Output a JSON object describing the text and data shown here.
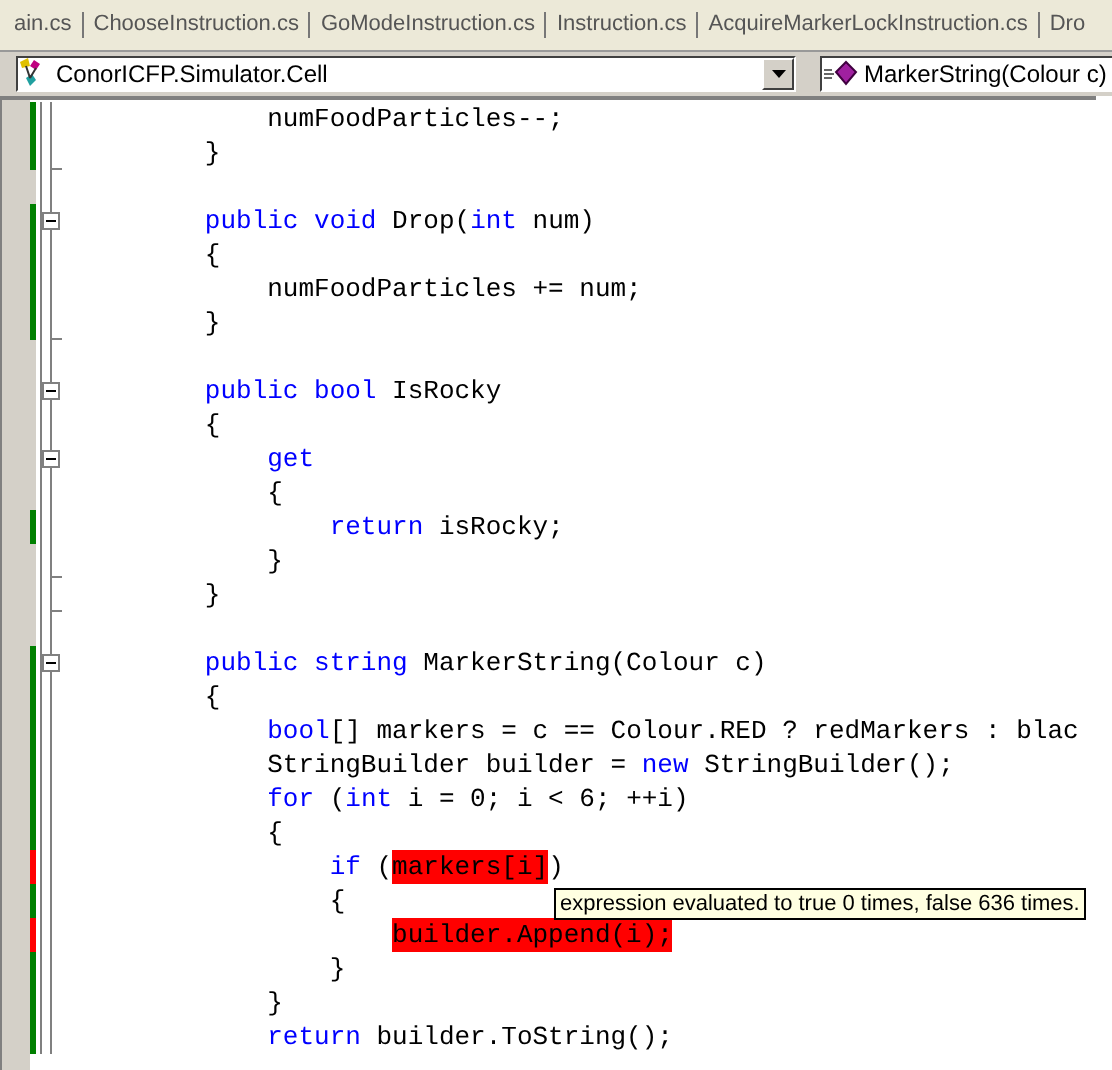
{
  "tabs": [
    {
      "label": "ain.cs",
      "selected": false
    },
    {
      "label": "ChooseInstruction.cs",
      "selected": false
    },
    {
      "label": "GoModeInstruction.cs",
      "selected": false
    },
    {
      "label": "Instruction.cs",
      "selected": false
    },
    {
      "label": "AcquireMarkerLockInstruction.cs",
      "selected": false
    },
    {
      "label": "Dro",
      "selected": false
    }
  ],
  "type_combo": {
    "value": "ConorICFP.Simulator.Cell"
  },
  "member_combo": {
    "value": "MarkerString(Colour c)"
  },
  "code_lines": [
    {
      "color": "#008000",
      "collapsible": false,
      "block_end": false,
      "tokens": [
        {
          "kind": "plain",
          "text": "            numFoodParticles--;"
        }
      ]
    },
    {
      "color": "#008000",
      "collapsible": false,
      "block_end": true,
      "tokens": [
        {
          "kind": "plain",
          "text": "        }"
        }
      ]
    },
    {
      "collapsible": false,
      "block_end": false
    },
    {
      "color": "#008000",
      "collapsible": true,
      "block_end": false,
      "tokens": [
        {
          "kind": "keyword",
          "text": "        public void"
        },
        {
          "kind": "plain",
          "text": " Drop("
        },
        {
          "kind": "keyword",
          "text": "int"
        },
        {
          "kind": "plain",
          "text": " num)"
        }
      ]
    },
    {
      "color": "#008000",
      "collapsible": false,
      "block_end": false,
      "tokens": [
        {
          "kind": "plain",
          "text": "        {"
        }
      ]
    },
    {
      "color": "#008000",
      "collapsible": false,
      "block_end": false,
      "tokens": [
        {
          "kind": "plain",
          "text": "            numFoodParticles += num;"
        }
      ]
    },
    {
      "color": "#008000",
      "collapsible": false,
      "block_end": true,
      "tokens": [
        {
          "kind": "plain",
          "text": "        }"
        }
      ]
    },
    {
      "collapsible": false,
      "block_end": false
    },
    {
      "collapsible": true,
      "block_end": false,
      "tokens": [
        {
          "kind": "keyword",
          "text": "        public bool"
        },
        {
          "kind": "plain",
          "text": " IsRocky"
        }
      ]
    },
    {
      "collapsible": false,
      "block_end": false,
      "tokens": [
        {
          "kind": "plain",
          "text": "        {"
        }
      ]
    },
    {
      "collapsible": true,
      "block_end": false,
      "tokens": [
        {
          "kind": "keyword",
          "text": "            get"
        }
      ]
    },
    {
      "collapsible": false,
      "block_end": false,
      "tokens": [
        {
          "kind": "plain",
          "text": "            {"
        }
      ]
    },
    {
      "color": "#008000",
      "collapsible": false,
      "block_end": false,
      "tokens": [
        {
          "kind": "keyword",
          "text": "                return"
        },
        {
          "kind": "plain",
          "text": " isRocky;"
        }
      ]
    },
    {
      "collapsible": false,
      "block_end": true,
      "tokens": [
        {
          "kind": "plain",
          "text": "            }"
        }
      ]
    },
    {
      "collapsible": false,
      "block_end": true,
      "tokens": [
        {
          "kind": "plain",
          "text": "        }"
        }
      ]
    },
    {
      "collapsible": false,
      "block_end": false
    },
    {
      "color": "#008000",
      "collapsible": true,
      "block_end": false,
      "tokens": [
        {
          "kind": "keyword",
          "text": "        public string"
        },
        {
          "kind": "plain",
          "text": " MarkerString(Colour c)"
        }
      ]
    },
    {
      "color": "#008000",
      "collapsible": false,
      "block_end": false,
      "tokens": [
        {
          "kind": "plain",
          "text": "        {"
        }
      ]
    },
    {
      "color": "#008000",
      "collapsible": false,
      "block_end": false,
      "tokens": [
        {
          "kind": "keyword",
          "text": "            bool"
        },
        {
          "kind": "plain",
          "text": "[] markers = c == Colour.RED ? redMarkers : blac"
        }
      ]
    },
    {
      "color": "#008000",
      "collapsible": false,
      "block_end": false,
      "tokens": [
        {
          "kind": "plain",
          "text": "            StringBuilder builder = "
        },
        {
          "kind": "keyword",
          "text": "new"
        },
        {
          "kind": "plain",
          "text": " StringBuilder();"
        }
      ]
    },
    {
      "color": "#008000",
      "collapsible": false,
      "block_end": false,
      "tokens": [
        {
          "kind": "keyword",
          "text": "            for"
        },
        {
          "kind": "plain",
          "text": " ("
        },
        {
          "kind": "keyword",
          "text": "int"
        },
        {
          "kind": "plain",
          "text": " i = 0; i < 6; ++i)"
        }
      ]
    },
    {
      "color": "#008000",
      "collapsible": false,
      "block_end": false,
      "tokens": [
        {
          "kind": "plain",
          "text": "            {"
        }
      ]
    },
    {
      "color": "#ff0000",
      "collapsible": false,
      "block_end": false,
      "tokens": [
        {
          "kind": "keyword",
          "text": "                if"
        },
        {
          "kind": "plain",
          "text": " ("
        },
        {
          "kind": "uncovered",
          "text": "markers[i]"
        },
        {
          "kind": "plain",
          "text": ")"
        }
      ]
    },
    {
      "color": "#008000",
      "collapsible": false,
      "block_end": false,
      "tokens": [
        {
          "kind": "plain",
          "text": "                {"
        }
      ]
    },
    {
      "color": "#ff0000",
      "collapsible": false,
      "block_end": false,
      "tokens": [
        {
          "kind": "uncovered",
          "text": "                    builder.Append(i);"
        }
      ]
    },
    {
      "color": "#008000",
      "collapsible": false,
      "block_end": false,
      "tokens": [
        {
          "kind": "plain",
          "text": "                }"
        }
      ]
    },
    {
      "color": "#008000",
      "collapsible": false,
      "block_end": false,
      "tokens": [
        {
          "kind": "plain",
          "text": "            }"
        }
      ]
    },
    {
      "color": "#008000",
      "collapsible": false,
      "block_end": false,
      "tokens": [
        {
          "kind": "keyword",
          "text": "            return"
        },
        {
          "kind": "plain",
          "text": " builder.ToString();"
        }
      ]
    }
  ],
  "tooltip": {
    "text": "expression evaluated to true 0 times, false 636 times."
  }
}
